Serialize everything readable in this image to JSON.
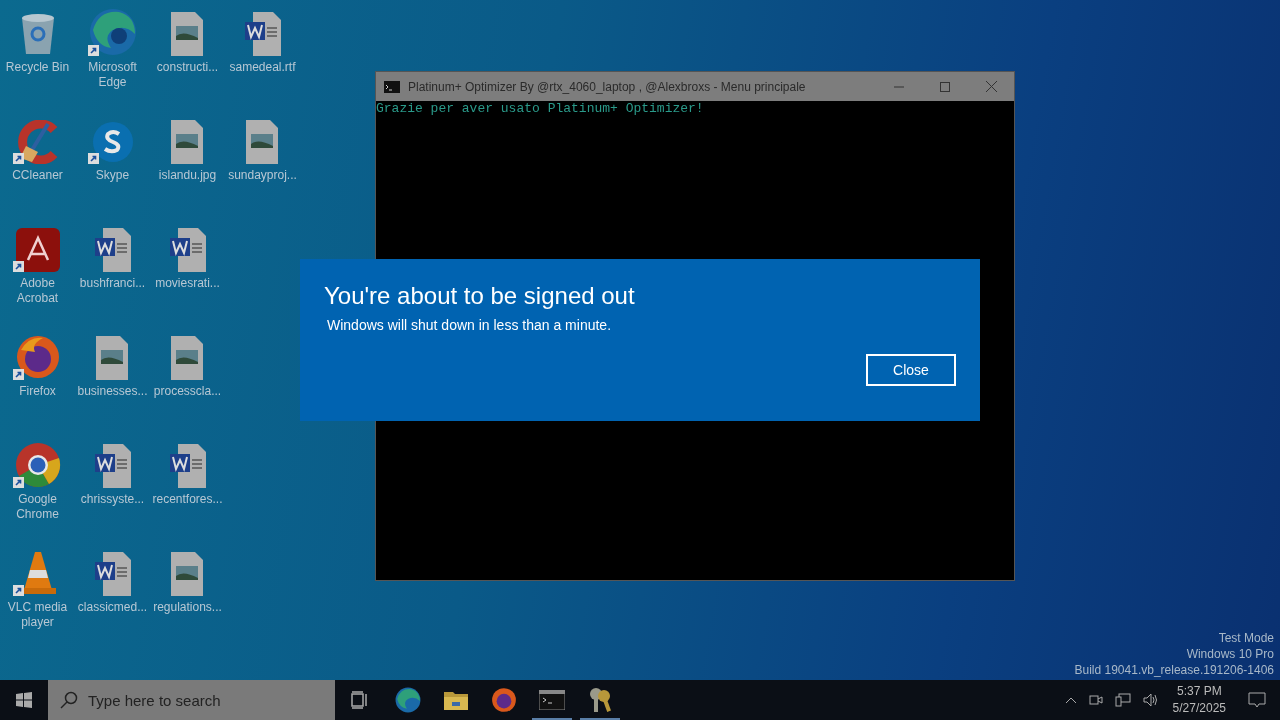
{
  "desktop_icons": [
    {
      "label": "Recycle Bin",
      "kind": "recycle",
      "shortcut": false
    },
    {
      "label": "CCleaner",
      "kind": "ccleaner",
      "shortcut": true
    },
    {
      "label": "Adobe Acrobat",
      "kind": "acrobat",
      "shortcut": true
    },
    {
      "label": "Firefox",
      "kind": "firefox",
      "shortcut": true
    },
    {
      "label": "Google Chrome",
      "kind": "chrome",
      "shortcut": true
    },
    {
      "label": "VLC media player",
      "kind": "vlc",
      "shortcut": true
    },
    {
      "label": "Microsoft Edge",
      "kind": "edge",
      "shortcut": true
    },
    {
      "label": "Skype",
      "kind": "skype",
      "shortcut": true
    },
    {
      "label": "bushfranci...",
      "kind": "word",
      "shortcut": false
    },
    {
      "label": "businesses...",
      "kind": "image",
      "shortcut": false
    },
    {
      "label": "chrissyste...",
      "kind": "word",
      "shortcut": false
    },
    {
      "label": "classicmed...",
      "kind": "word",
      "shortcut": false
    },
    {
      "label": "constructi...",
      "kind": "image",
      "shortcut": false
    },
    {
      "label": "islandu.jpg",
      "kind": "image",
      "shortcut": false
    },
    {
      "label": "moviesrati...",
      "kind": "word",
      "shortcut": false
    },
    {
      "label": "processcla...",
      "kind": "image",
      "shortcut": false
    },
    {
      "label": "recentfores...",
      "kind": "word",
      "shortcut": false
    },
    {
      "label": "regulations...",
      "kind": "image",
      "shortcut": false
    },
    {
      "label": "samedeal.rtf",
      "kind": "word",
      "shortcut": false
    },
    {
      "label": "sundayproj...",
      "kind": "image",
      "shortcut": false
    }
  ],
  "console_window": {
    "title": "Platinum+ Optimizer By @rtx_4060_laptop , @Alexbroxs - Menu principale",
    "output": "Grazie per aver usato Platinum+ Optimizer!"
  },
  "dialog": {
    "title": "You're about to be signed out",
    "message": "Windows will shut down in less than a minute.",
    "button": "Close"
  },
  "system_watermark": [
    "Test Mode",
    "Windows 10 Pro",
    "Build 19041.vb_release.191206-1406"
  ],
  "taskbar": {
    "search": {
      "placeholder": "Type here to search"
    },
    "apps": [
      {
        "kind": "taskview",
        "running": false
      },
      {
        "kind": "edge",
        "running": false
      },
      {
        "kind": "folder",
        "running": false
      },
      {
        "kind": "firefox",
        "running": false
      },
      {
        "kind": "console",
        "running": true
      },
      {
        "kind": "keys",
        "running": true
      }
    ],
    "time": "5:37 PM",
    "date": "5/27/2025"
  }
}
